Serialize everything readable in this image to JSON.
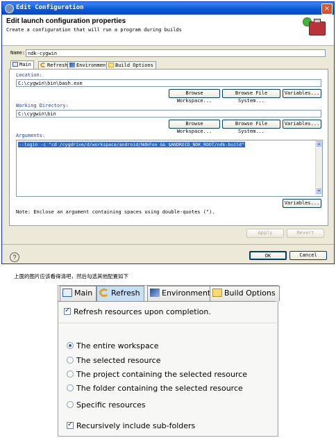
{
  "window": {
    "title": "Edit Configuration",
    "close_glyph": "×"
  },
  "header": {
    "title": "Edit launch configuration properties",
    "description": "Create a configuration that will run a program during builds"
  },
  "name": {
    "label": "Name:",
    "value": "ndk-cygwin"
  },
  "tabs": [
    {
      "label": "Main",
      "icon": "main-tab-icon"
    },
    {
      "label": "Refresh",
      "icon": "refresh-icon"
    },
    {
      "label": "Environment",
      "icon": "environment-icon"
    },
    {
      "label": "Build Options",
      "icon": "build-options-icon"
    }
  ],
  "main": {
    "location": {
      "label": "Location:",
      "value": "C:\\cygwin\\bin\\bash.exe"
    },
    "working_dir": {
      "label": "Working Directory:",
      "value": "C:\\cygwin\\bin"
    },
    "arguments": {
      "label": "Arguments:",
      "value": "--login -c \"cd /cygdrive/d/workspace/android/NdkFoo && $ANDROID_NDK_ROOT/ndk-build\""
    },
    "browse_workspace": "Browse Workspace...",
    "browse_filesystem": "Browse File System...",
    "variables": "Variables...",
    "note": "Note: Enclose an argument containing spaces using double-quotes (\")."
  },
  "actions": {
    "apply": "Apply",
    "revert": "Revert",
    "ok": "OK",
    "cancel": "Cancel",
    "help": "?"
  },
  "caption": "上面的图片应该看得清吧，然后勾选其他配置如下",
  "refresh_zoom": {
    "tabs": [
      "Main",
      "Refresh",
      "Environment",
      "Build Options"
    ],
    "refresh_on_completion": "Refresh resources upon completion.",
    "options": [
      "The entire workspace",
      "The selected resource",
      "The project containing the selected resource",
      "The folder containing the selected resource",
      "Specific resources"
    ],
    "selected_option": 0,
    "recursive": "Recursively include sub-folders"
  },
  "colors": {
    "title_bar": "#0a56d6",
    "selection": "#316ac5",
    "dialog_bg": "#ece9d8"
  }
}
